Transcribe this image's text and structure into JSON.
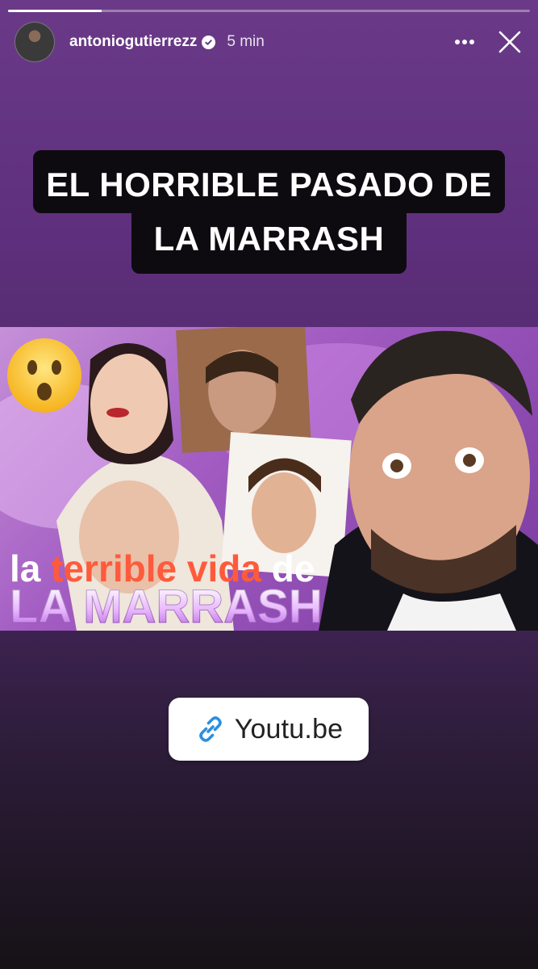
{
  "story": {
    "progress": 0.18,
    "username": "antoniogutierrezz",
    "time": "5 min"
  },
  "caption": {
    "line1": "EL HORRIBLE PASADO DE",
    "line2": "LA MARRASH"
  },
  "video_thumbnail": {
    "title_word1": "la ",
    "title_word2": "terrible vida",
    "title_word3": " de",
    "title_line2": "LA MARRASH"
  },
  "link_sticker": {
    "label": "Youtu.be",
    "icon": "link-icon"
  },
  "icons": {
    "verified": "verified-badge-icon",
    "more": "more-options-icon",
    "close": "close-icon"
  },
  "colors": {
    "accent_red": "#ff5a3c",
    "link_blue": "#2b8fe0"
  }
}
